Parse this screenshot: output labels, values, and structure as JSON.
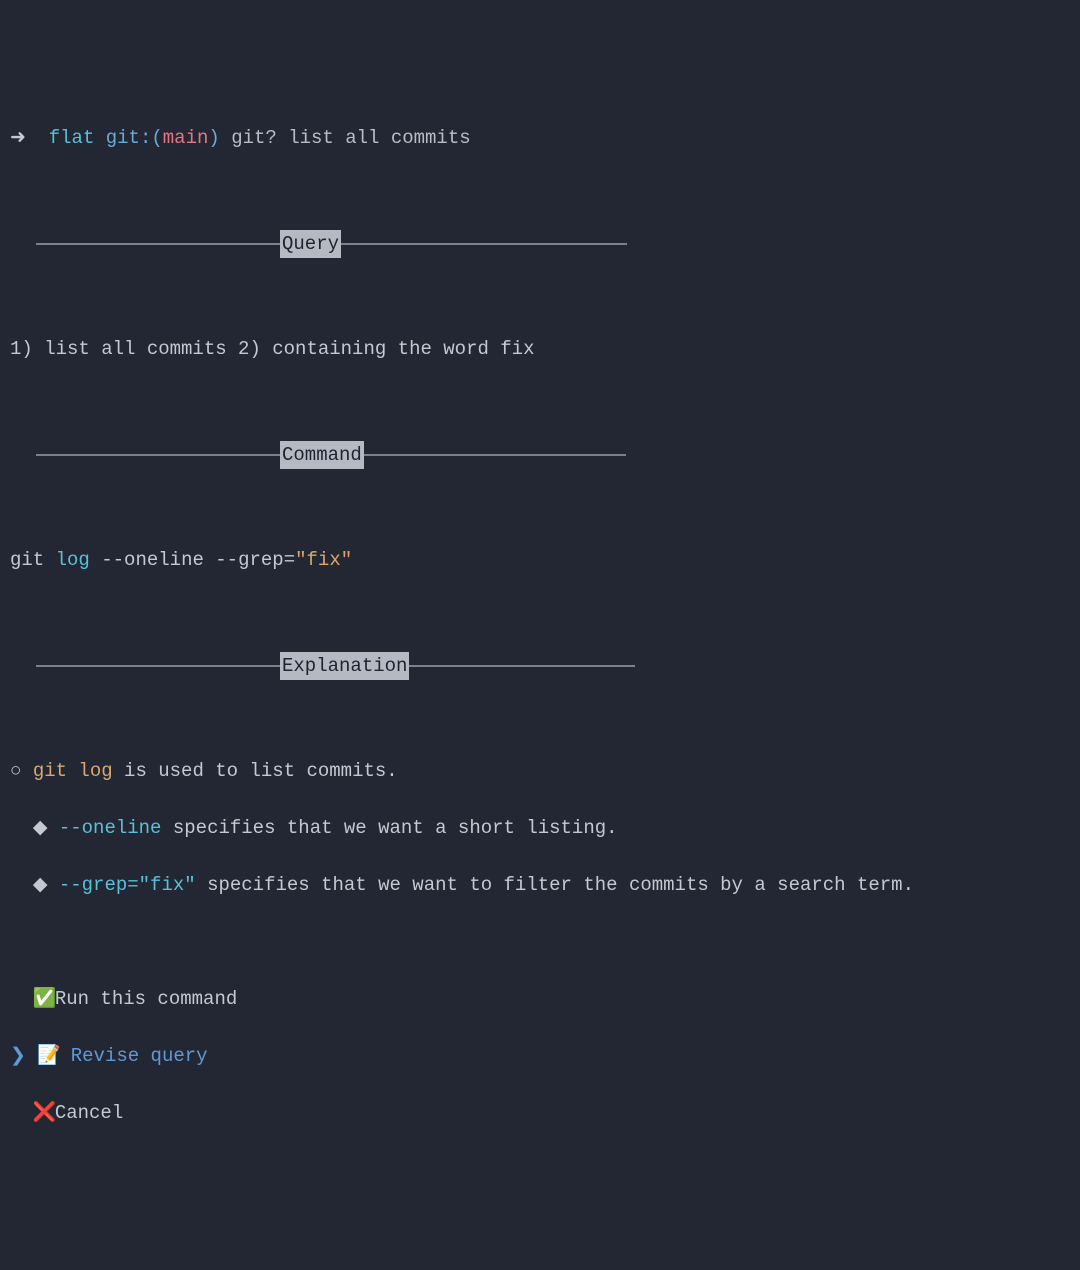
{
  "prompt": {
    "arrow": "➜",
    "dir": "flat",
    "git_label": "git:",
    "paren_open": "(",
    "branch": "main",
    "paren_close": ")",
    "cmd": "git? list all commits"
  },
  "sections": {
    "query_label": "Query",
    "command_label": "Command",
    "explanation_label": "Explanation"
  },
  "query": "1) list all commits 2) containing the word fix",
  "command": {
    "git": "git",
    "log": "log",
    "oneline": "--oneline",
    "grep_flag": "--grep=",
    "grep_val": "\"fix\""
  },
  "explanation": {
    "bullet_circle": "○",
    "bullet_diamond": "◆",
    "line1_cmd": "git log",
    "line1_rest": " is used to list commits.",
    "line2_flag": "--oneline",
    "line2_rest": " specifies that we want a short listing.",
    "line3_flag": "--grep=\"fix\"",
    "line3_rest": " specifies that we want to filter the commits by a search term."
  },
  "menu": {
    "cursor": "❯",
    "items": [
      {
        "icon": "✅",
        "label": "Run this command",
        "selected": false
      },
      {
        "icon": "📝",
        "label": "Revise query",
        "selected": true
      },
      {
        "icon": "❌",
        "label": "Cancel",
        "selected": false
      }
    ]
  }
}
